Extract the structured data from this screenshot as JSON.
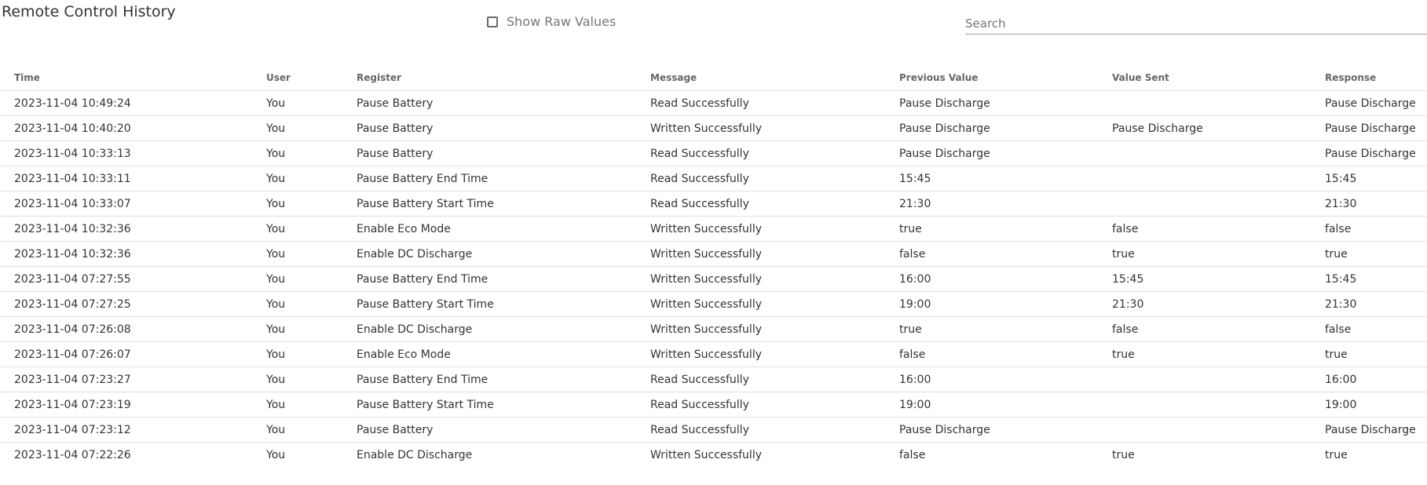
{
  "page": {
    "title": "Remote Control History"
  },
  "toolbar": {
    "raw_values_label": "Show Raw Values",
    "raw_values_checked": false,
    "search_placeholder": "Search",
    "search_value": ""
  },
  "table": {
    "columns": [
      "Time",
      "User",
      "Register",
      "Message",
      "Previous Value",
      "Value Sent",
      "Response"
    ],
    "rows": [
      [
        "2023-11-04 10:49:24",
        "You",
        "Pause Battery",
        "Read Successfully",
        "Pause Discharge",
        "",
        "Pause Discharge"
      ],
      [
        "2023-11-04 10:40:20",
        "You",
        "Pause Battery",
        "Written Successfully",
        "Pause Discharge",
        "Pause Discharge",
        "Pause Discharge"
      ],
      [
        "2023-11-04 10:33:13",
        "You",
        "Pause Battery",
        "Read Successfully",
        "Pause Discharge",
        "",
        "Pause Discharge"
      ],
      [
        "2023-11-04 10:33:11",
        "You",
        "Pause Battery End Time",
        "Read Successfully",
        "15:45",
        "",
        "15:45"
      ],
      [
        "2023-11-04 10:33:07",
        "You",
        "Pause Battery Start Time",
        "Read Successfully",
        "21:30",
        "",
        "21:30"
      ],
      [
        "2023-11-04 10:32:36",
        "You",
        "Enable Eco Mode",
        "Written Successfully",
        "true",
        "false",
        "false"
      ],
      [
        "2023-11-04 10:32:36",
        "You",
        "Enable DC Discharge",
        "Written Successfully",
        "false",
        "true",
        "true"
      ],
      [
        "2023-11-04 07:27:55",
        "You",
        "Pause Battery End Time",
        "Written Successfully",
        "16:00",
        "15:45",
        "15:45"
      ],
      [
        "2023-11-04 07:27:25",
        "You",
        "Pause Battery Start Time",
        "Written Successfully",
        "19:00",
        "21:30",
        "21:30"
      ],
      [
        "2023-11-04 07:26:08",
        "You",
        "Enable DC Discharge",
        "Written Successfully",
        "true",
        "false",
        "false"
      ],
      [
        "2023-11-04 07:26:07",
        "You",
        "Enable Eco Mode",
        "Written Successfully",
        "false",
        "true",
        "true"
      ],
      [
        "2023-11-04 07:23:27",
        "You",
        "Pause Battery End Time",
        "Read Successfully",
        "16:00",
        "",
        "16:00"
      ],
      [
        "2023-11-04 07:23:19",
        "You",
        "Pause Battery Start Time",
        "Read Successfully",
        "19:00",
        "",
        "19:00"
      ],
      [
        "2023-11-04 07:23:12",
        "You",
        "Pause Battery",
        "Read Successfully",
        "Pause Discharge",
        "",
        "Pause Discharge"
      ],
      [
        "2023-11-04 07:22:26",
        "You",
        "Enable DC Discharge",
        "Written Successfully",
        "false",
        "true",
        "true"
      ]
    ]
  }
}
